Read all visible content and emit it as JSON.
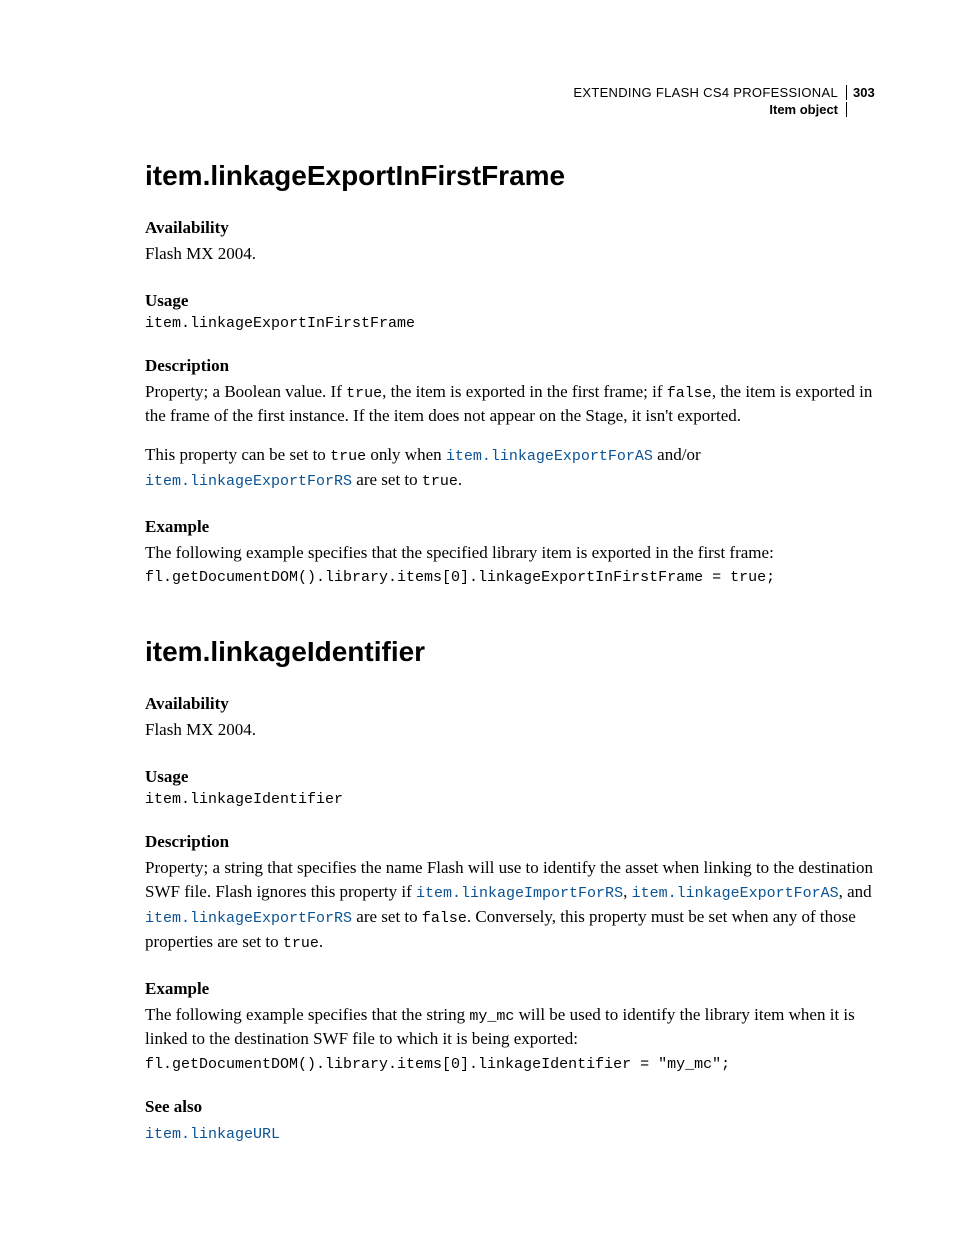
{
  "header": {
    "book_title": "EXTENDING FLASH CS4 PROFESSIONAL",
    "chapter": "Item object",
    "page_number": "303"
  },
  "section1": {
    "title": "item.linkageExportInFirstFrame",
    "availability_h": "Availability",
    "availability_b": "Flash MX 2004.",
    "usage_h": "Usage",
    "usage_code": "item.linkageExportInFirstFrame",
    "description_h": "Description",
    "desc_p1_a": "Property; a Boolean value. If ",
    "desc_p1_true": "true",
    "desc_p1_b": ", the item is exported in the first frame; if ",
    "desc_p1_false": "false",
    "desc_p1_c": ", the item is exported in the frame of the first instance. If the item does not appear on the Stage, it isn't exported.",
    "desc_p2_a": "This property can be set to ",
    "desc_p2_true": "true",
    "desc_p2_b": " only when ",
    "desc_p2_link1": "item.linkageExportForAS",
    "desc_p2_c": " and/or ",
    "desc_p2_link2": "item.linkageExportForRS",
    "desc_p2_d": " are set to ",
    "desc_p2_true2": "true",
    "desc_p2_e": ".",
    "example_h": "Example",
    "example_intro": "The following example specifies that the specified library item is exported in the first frame:",
    "example_code": "fl.getDocumentDOM().library.items[0].linkageExportInFirstFrame = true;"
  },
  "section2": {
    "title": "item.linkageIdentifier",
    "availability_h": "Availability",
    "availability_b": "Flash MX 2004.",
    "usage_h": "Usage",
    "usage_code": "item.linkageIdentifier",
    "description_h": "Description",
    "desc_p1_a": "Property; a string that specifies the name Flash will use to identify the asset when linking to the destination SWF file. Flash ignores this property if ",
    "desc_p1_link1": "item.linkageImportForRS",
    "desc_p1_b": ", ",
    "desc_p1_link2": "item.linkageExportForAS",
    "desc_p1_c": ", and ",
    "desc_p1_link3": "item.linkageExportForRS",
    "desc_p1_d": " are set to ",
    "desc_p1_false": "false",
    "desc_p1_e": ". Conversely, this property must be set when any of those properties are set to ",
    "desc_p1_true": "true",
    "desc_p1_f": ".",
    "example_h": "Example",
    "example_intro_a": "The following example specifies that the string ",
    "example_intro_code": "my_mc",
    "example_intro_b": " will be used to identify the library item when it is linked to the destination SWF file to which it is being exported:",
    "example_code": "fl.getDocumentDOM().library.items[0].linkageIdentifier = \"my_mc\";",
    "seealso_h": "See also",
    "seealso_link": "item.linkageURL"
  }
}
